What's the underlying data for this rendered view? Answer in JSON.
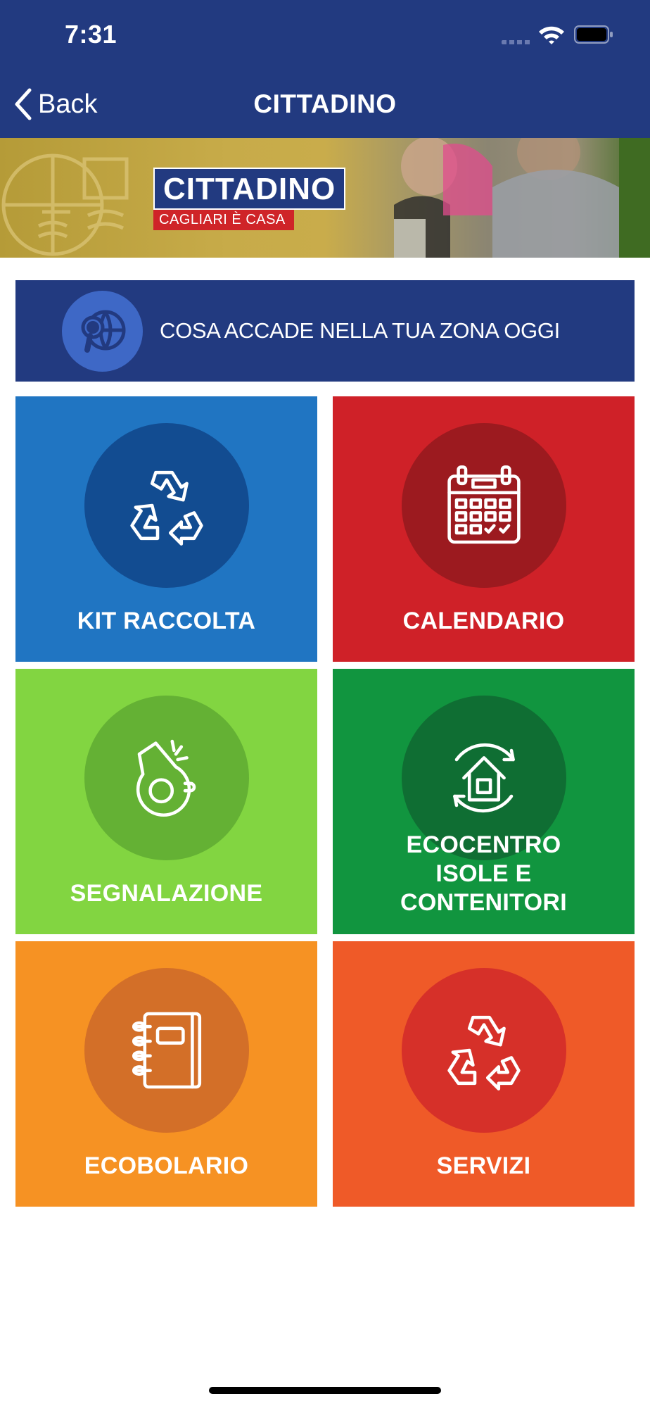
{
  "status_bar": {
    "time": "7:31"
  },
  "nav": {
    "back_label": "Back",
    "title": "CITTADINO"
  },
  "hero": {
    "brand_title": "CITTADINO",
    "brand_subtitle": "CAGLIARI È CASA"
  },
  "zone_banner": {
    "label": "COSA ACCADE NELLA TUA ZONA OGGI",
    "icon": "globe-search-icon"
  },
  "tiles": [
    {
      "label": "KIT RACCOLTA",
      "icon": "recycle-icon",
      "color": "#2075c2"
    },
    {
      "label": "CALENDARIO",
      "icon": "calendar-icon",
      "color": "#cf2128"
    },
    {
      "label": "SEGNALAZIONE",
      "icon": "whistle-icon",
      "color": "#82d541"
    },
    {
      "label_lines": [
        "ECOCENTRO",
        "ISOLE E",
        "CONTENITORI"
      ],
      "icon": "house-cycle-icon",
      "color": "#11953f"
    },
    {
      "label": "ECOBOLARIO",
      "icon": "notebook-icon",
      "color": "#f69223"
    },
    {
      "label": "SERVIZI",
      "icon": "recycle-icon",
      "color": "#ef5a28"
    }
  ]
}
